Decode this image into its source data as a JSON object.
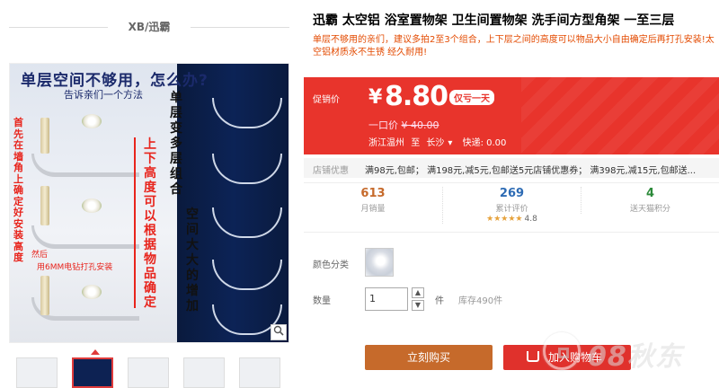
{
  "shop": {
    "name": "XB/迅霸"
  },
  "image": {
    "headline": "单层空间不够用，怎么办?",
    "subheadline": "告诉亲们一个方法",
    "red_vertical": "首先在墙角上确定好安装高度",
    "mid_vertical": "上下高度可以根据物品确定",
    "black_vertical_1": "单层变多层组合",
    "black_vertical_2": "空间大大的增加",
    "note_1": "然后",
    "note_2": "用6MM电钻打孔安装",
    "zoom_icon": "magnifier-icon"
  },
  "product": {
    "title": "迅霸 太空铝 浴室置物架 卫生间置物架 洗手间方型角架 一至三层",
    "subtitle": "单层不够用的亲们，建议多拍2至3个组合，上下层之间的高度可以物品大小自由确定后再打孔安装!太空铝材质永不生锈 经久耐用!"
  },
  "price": {
    "promo_label": "促销价",
    "currency": "¥",
    "value": "8.80",
    "badge": "仅亏一天",
    "orig_label": "一口价",
    "orig_value": "¥ 40.00",
    "origin": "浙江温州",
    "to": "至",
    "dest": "长沙",
    "dest_caret": "▾",
    "shipping": "快递: 0.00"
  },
  "promotions": {
    "label": "店铺优惠",
    "text": "满98元,包邮； 满198元,减5元,包邮送5元店铺优惠券； 满398元,减15元,包邮送..."
  },
  "stats": [
    {
      "value": "613",
      "caption": "月销量",
      "color": "#c66a2b"
    },
    {
      "value": "269",
      "caption": "累计评价",
      "color": "#2d6bb4",
      "stars": "★★★★★",
      "rating": "4.8"
    },
    {
      "value": "4",
      "caption": "送天猫积分",
      "color": "#2c8a3a"
    }
  ],
  "options": {
    "color_label": "颜色分类",
    "qty_label": "数量",
    "qty_value": "1",
    "qty_unit": "件",
    "stock": "库存490件"
  },
  "actions": {
    "buy": "立刻购买",
    "cart": "加入购物车"
  },
  "watermark": {
    "text": "08秋东"
  },
  "colors": {
    "accent": "#e8342c",
    "buy": "#c66a2b",
    "cart": "#e0312c",
    "subtitle": "#e34a00"
  }
}
